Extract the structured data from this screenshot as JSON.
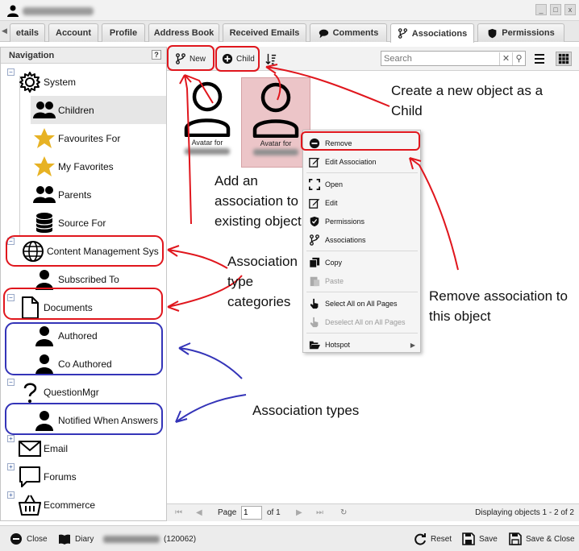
{
  "window": {
    "minimize": "_",
    "maximize": "□",
    "close": "x"
  },
  "tabs": [
    {
      "label": "etails"
    },
    {
      "label": "Account"
    },
    {
      "label": "Profile"
    },
    {
      "label": "Address Book"
    },
    {
      "label": "Received Emails"
    },
    {
      "label": "Comments"
    },
    {
      "label": "Associations"
    },
    {
      "label": "Permissions"
    }
  ],
  "navigation": {
    "title": "Navigation",
    "help": "?",
    "items": [
      {
        "label": "System"
      },
      {
        "label": "Children"
      },
      {
        "label": "Favourites For"
      },
      {
        "label": "My Favorites"
      },
      {
        "label": "Parents"
      },
      {
        "label": "Source For"
      },
      {
        "label": "Content Management Sys"
      },
      {
        "label": "Subscribed To"
      },
      {
        "label": "Documents"
      },
      {
        "label": "Authored"
      },
      {
        "label": "Co Authored"
      },
      {
        "label": "QuestionMgr"
      },
      {
        "label": "Notified When Answers"
      },
      {
        "label": "Email"
      },
      {
        "label": "Forums"
      },
      {
        "label": "Ecommerce"
      }
    ]
  },
  "toolbar": {
    "new_label": "New",
    "child_label": "Child",
    "search_placeholder": "Search"
  },
  "tiles": [
    {
      "caption": "Avatar for"
    },
    {
      "caption": "Avatar for"
    }
  ],
  "context_menu": {
    "items": [
      {
        "label": "Remove"
      },
      {
        "label": "Edit Association"
      },
      {
        "label": "Open"
      },
      {
        "label": "Edit"
      },
      {
        "label": "Permissions"
      },
      {
        "label": "Associations"
      },
      {
        "label": "Copy"
      },
      {
        "label": "Paste"
      },
      {
        "label": "Select All on All Pages"
      },
      {
        "label": "Deselect All on All Pages"
      },
      {
        "label": "Hotspot"
      }
    ]
  },
  "pager": {
    "page_label": "Page",
    "page_value": "1",
    "of_label": "of 1",
    "status": "Displaying objects 1 - 2 of 2"
  },
  "bottom": {
    "close": "Close",
    "diary": "Diary",
    "id": "(120062)",
    "reset": "Reset",
    "save": "Save",
    "save_close": "Save & Close"
  },
  "annotations": {
    "create_child": "Create a new object as a Child",
    "add_assoc": "Add an association to existing object",
    "type_categories": "Association type categories",
    "remove_assoc": "Remove association to this object",
    "assoc_types": "Association types"
  },
  "colors": {
    "annotation_red": "#e0161d",
    "annotation_blue": "#3434b8",
    "selected_tile": "#ecc5c8"
  }
}
